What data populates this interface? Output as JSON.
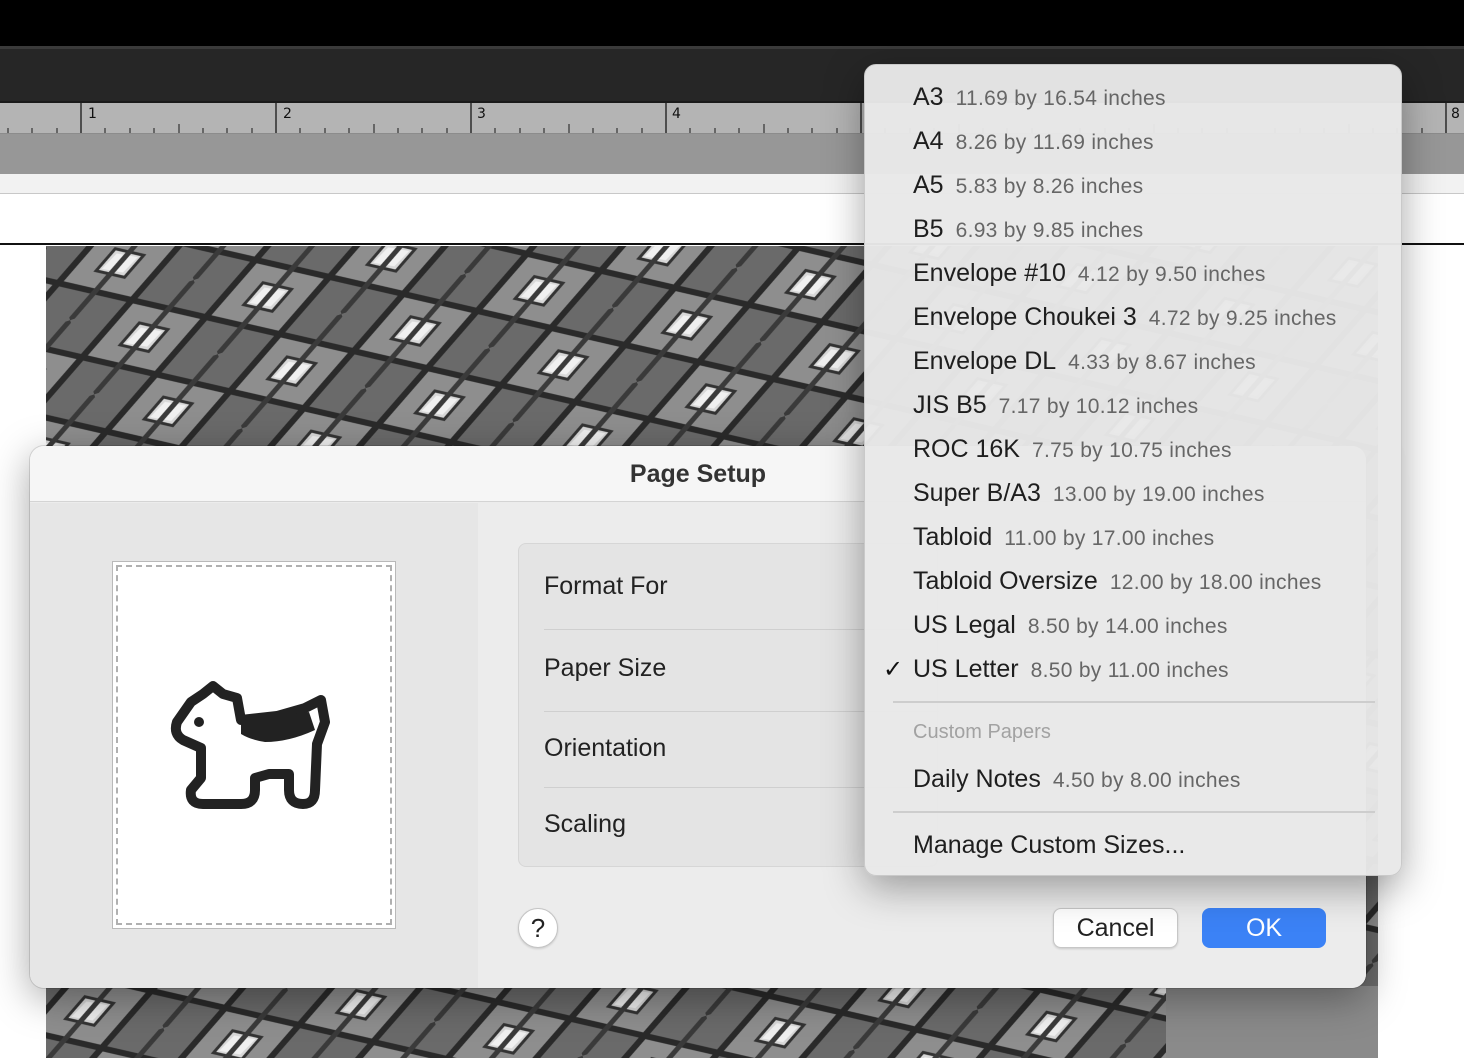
{
  "dialog": {
    "title": "Page Setup",
    "settings": [
      "Format For",
      "Paper Size",
      "Orientation",
      "Scaling"
    ],
    "help_label": "?",
    "cancel_label": "Cancel",
    "ok_label": "OK",
    "accent_color": "#3b82f6"
  },
  "ruler": {
    "labels": [
      "1",
      "2",
      "3",
      "4",
      "8"
    ]
  },
  "paper_menu": {
    "items": [
      {
        "name": "A3",
        "size": "11.69 by 16.54 inches"
      },
      {
        "name": "A4",
        "size": "8.26 by 11.69 inches"
      },
      {
        "name": "A5",
        "size": "5.83 by 8.26 inches"
      },
      {
        "name": "B5",
        "size": "6.93 by 9.85 inches"
      },
      {
        "name": "Envelope #10",
        "size": "4.12 by 9.50 inches"
      },
      {
        "name": "Envelope Choukei 3",
        "size": "4.72 by 9.25 inches"
      },
      {
        "name": "Envelope DL",
        "size": "4.33 by 8.67 inches"
      },
      {
        "name": "JIS B5",
        "size": "7.17 by 10.12 inches"
      },
      {
        "name": "ROC 16K",
        "size": "7.75 by 10.75 inches"
      },
      {
        "name": "Super B/A3",
        "size": "13.00 by 19.00 inches"
      },
      {
        "name": "Tabloid",
        "size": "11.00 by 17.00 inches"
      },
      {
        "name": "Tabloid Oversize",
        "size": "12.00 by 18.00 inches"
      },
      {
        "name": "US Legal",
        "size": "8.50 by 14.00 inches"
      },
      {
        "name": "US Letter",
        "size": "8.50 by 11.00 inches"
      }
    ],
    "selected": "US Letter",
    "checkmark": "✓",
    "custom_header": "Custom Papers",
    "custom_items": [
      {
        "name": "Daily Notes",
        "size": "4.50 by 8.00 inches"
      }
    ],
    "manage_label": "Manage Custom Sizes..."
  }
}
